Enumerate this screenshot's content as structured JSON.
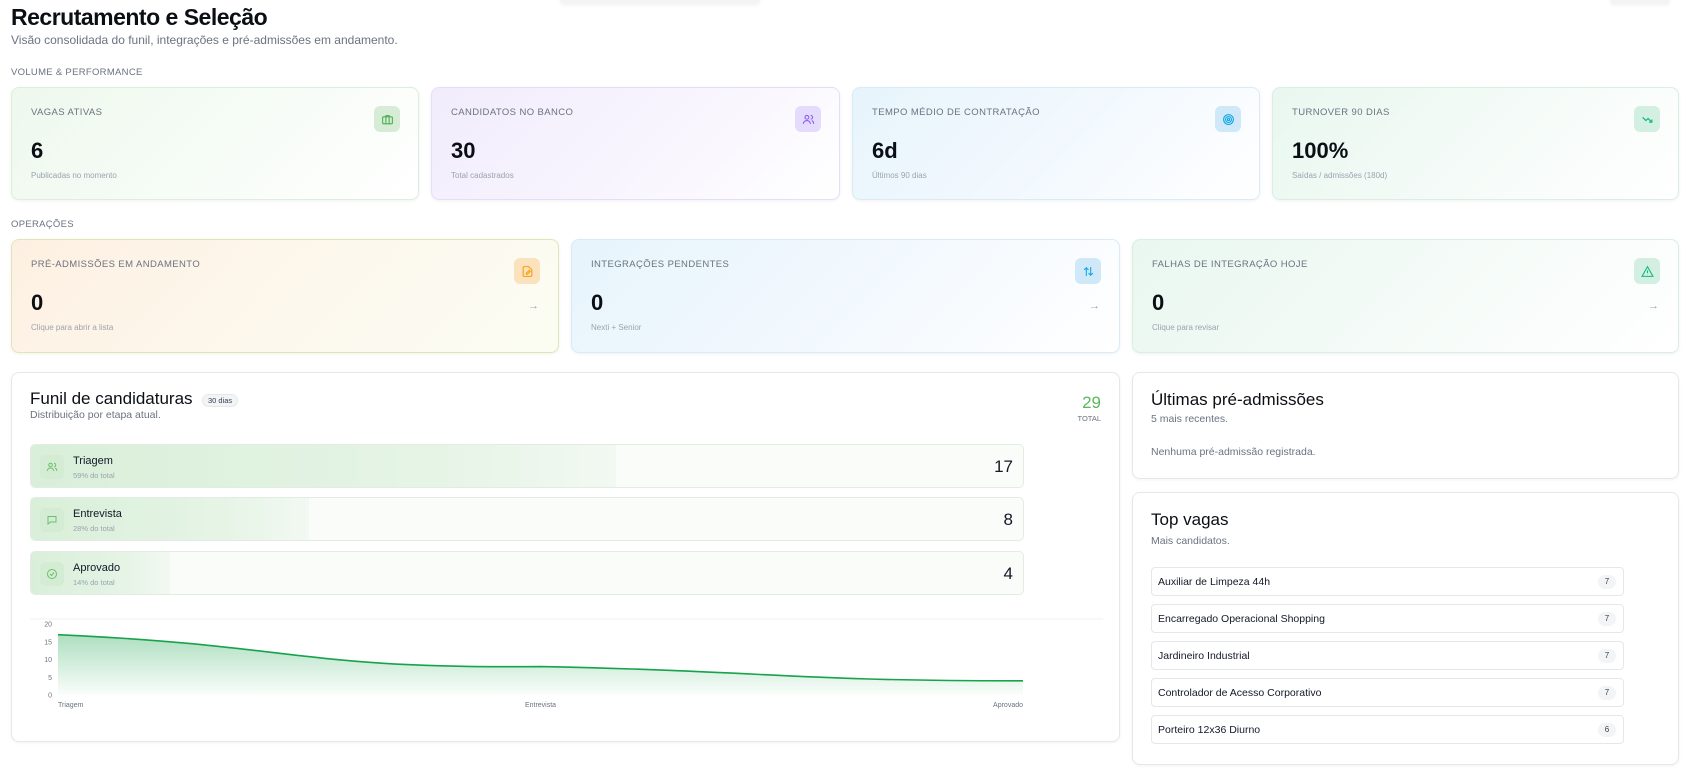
{
  "header": {
    "title": "Recrutamento e Seleção",
    "subtitle": "Visão consolidada do funil, integrações e pré-admissões em andamento."
  },
  "sections": {
    "volume": "VOLUME & PERFORMANCE",
    "operacoes": "OPERAÇÕES"
  },
  "kpis": [
    {
      "label": "VAGAS ATIVAS",
      "value": "6",
      "caption": "Publicadas no momento",
      "icon": "briefcase-icon",
      "color": "#4caf50"
    },
    {
      "label": "CANDIDATOS NO BANCO",
      "value": "30",
      "caption": "Total cadastrados",
      "icon": "users-icon",
      "color": "#8b5cf6"
    },
    {
      "label": "TEMPO MÉDIO DE CONTRATAÇÃO",
      "value": "6d",
      "caption": "Últimos 90 dias",
      "icon": "target-icon",
      "color": "#0ea5e9"
    },
    {
      "label": "TURNOVER 90 DIAS",
      "value": "100%",
      "caption": "Saídas / admissões (180d)",
      "icon": "trending-down-icon",
      "color": "#10b981"
    }
  ],
  "ops": [
    {
      "label": "PRÉ-ADMISSÕES EM ANDAMENTO",
      "value": "0",
      "caption": "Clique para abrir a lista",
      "icon": "edit-document-icon",
      "color": "#f59e0b"
    },
    {
      "label": "INTEGRAÇÕES PENDENTES",
      "value": "0",
      "caption": "Nexti + Senior",
      "icon": "arrows-swap-icon",
      "color": "#0ea5e9"
    },
    {
      "label": "FALHAS DE INTEGRAÇÃO HOJE",
      "value": "0",
      "caption": "Clique para revisar",
      "icon": "warning-icon",
      "color": "#10b981"
    }
  ],
  "funnel": {
    "title": "Funil de candidaturas",
    "badge": "30 dias",
    "subtitle": "Distribuição por etapa atual.",
    "total_value": "29",
    "total_label": "TOTAL",
    "stages": [
      {
        "name": "Triagem",
        "pct_text": "59% do total",
        "count": "17",
        "pct": 0.59,
        "icon": "users-icon"
      },
      {
        "name": "Entrevista",
        "pct_text": "28% do total",
        "count": "8",
        "pct": 0.28,
        "icon": "chat-icon"
      },
      {
        "name": "Aprovado",
        "pct_text": "14% do total",
        "count": "4",
        "pct": 0.14,
        "icon": "check-circle-icon"
      }
    ]
  },
  "chart_data": {
    "type": "area",
    "categories": [
      "Triagem",
      "Entrevista",
      "Aprovado"
    ],
    "values": [
      17,
      8,
      4
    ],
    "ylim": [
      0,
      20
    ],
    "yticks": [
      "20",
      "15",
      "10",
      "5",
      "0"
    ],
    "color": "#16a34a",
    "grid": false
  },
  "ultimas": {
    "title": "Últimas pré-admissões",
    "subtitle": "5 mais recentes.",
    "empty": "Nenhuma pré-admissão registrada."
  },
  "top_vagas": {
    "title": "Top vagas",
    "subtitle": "Mais candidatos.",
    "items": [
      {
        "name": "Auxiliar de Limpeza 44h",
        "count": "7"
      },
      {
        "name": "Encarregado Operacional Shopping",
        "count": "7"
      },
      {
        "name": "Jardineiro Industrial",
        "count": "7"
      },
      {
        "name": "Controlador de Acesso Corporativo",
        "count": "7"
      },
      {
        "name": "Porteiro 12x36 Diurno",
        "count": "6"
      }
    ]
  }
}
